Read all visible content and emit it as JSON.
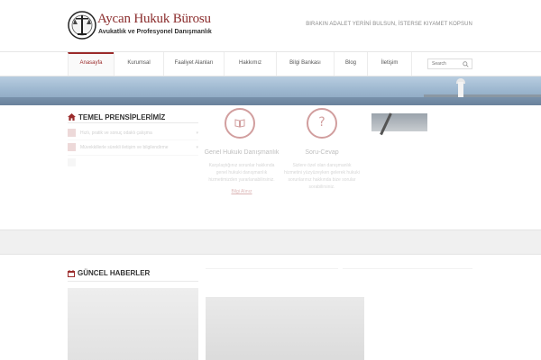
{
  "header": {
    "logo_title": "Aycan Hukuk Bürosu",
    "logo_subtitle": "Avukatlık ve Profesyonel Danışmanlık",
    "slogan": "BIRAKIN ADALET YERİNİ BULSUN, İSTERSE KIYAMET KOPSUN"
  },
  "nav": {
    "items": [
      {
        "label": "Anasayfa",
        "active": true
      },
      {
        "label": "Kurumsal",
        "active": false
      },
      {
        "label": "Faaliyet Alanları",
        "active": false
      },
      {
        "label": "Hakkımız",
        "active": false
      },
      {
        "label": "Bilgi Bankası",
        "active": false
      },
      {
        "label": "Blog",
        "active": false
      },
      {
        "label": "İletişim",
        "active": false
      }
    ],
    "search_placeholder": "Search"
  },
  "principles": {
    "title": "TEMEL PRENSİPLERİMİZ",
    "items": [
      "Hızlı, pratik ve sonuç odaklı çalışma",
      "Müvekkillerle sürekli iletişim ve bilgilendirme"
    ]
  },
  "features": [
    {
      "icon": "book-icon",
      "title": "Genel Hukuki Danışmanlık",
      "text": "Karşılaştığınız sorunlar hakkında genel hukuki danışmanlık hizmetimizden yararlanabilirsiniz.",
      "link": "Bilgi Alınız"
    },
    {
      "icon": "question-icon",
      "title": "Soru-Cevap",
      "text": "Sizlere özel olan danışmanlık hizmetini yüzyüzeyken gelerek hukuki sorunlarınız hakkında bize sorular sorabilirsiniz.",
      "link": ""
    }
  ],
  "news": {
    "title": "GÜNCEL HABERLER"
  },
  "colors": {
    "brand": "#9b2b2b",
    "band": "#f0f0f0"
  }
}
